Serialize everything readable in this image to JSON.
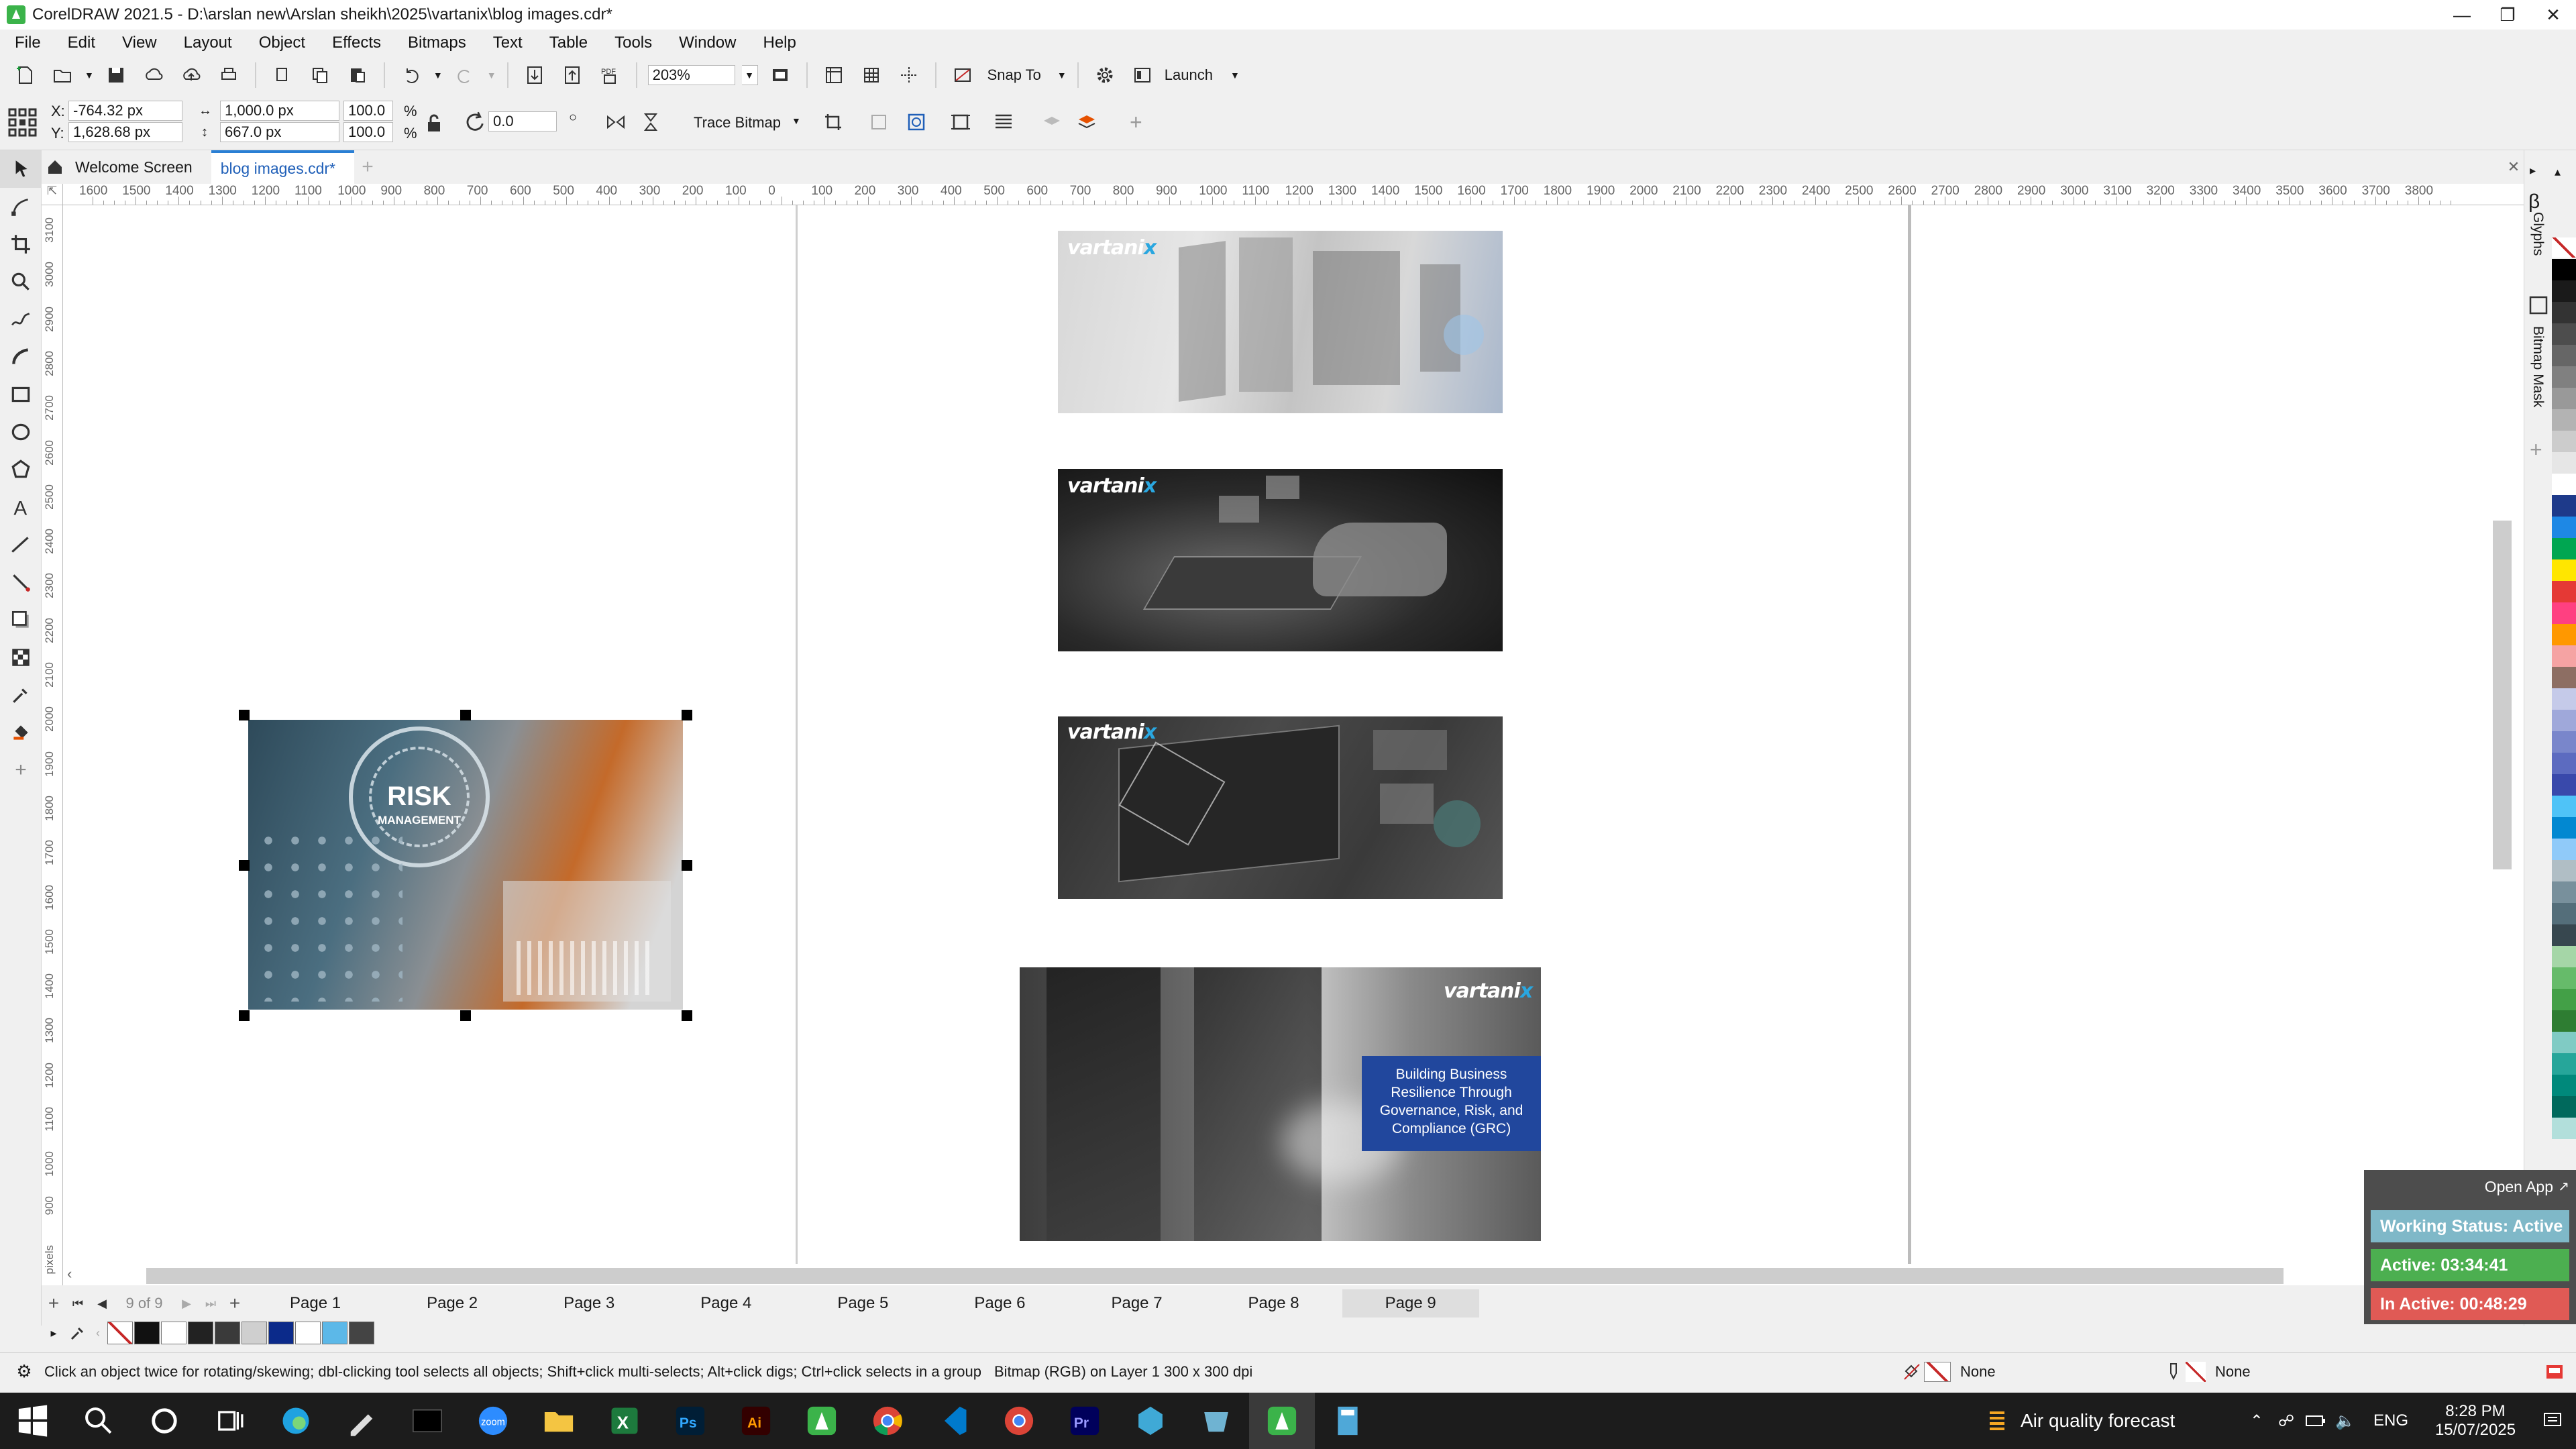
{
  "window": {
    "title": "CorelDRAW 2021.5 - D:\\arslan new\\Arslan sheikh\\2025\\vartanix\\blog images.cdr*",
    "app_icon": "coreldraw-icon",
    "controls": [
      "minimize-icon",
      "restore-icon",
      "close-icon"
    ]
  },
  "menu": [
    "File",
    "Edit",
    "View",
    "Layout",
    "Object",
    "Effects",
    "Bitmaps",
    "Text",
    "Table",
    "Tools",
    "Window",
    "Help"
  ],
  "toolbar": {
    "zoom": "203%",
    "snap_to": "Snap To",
    "launch": "Launch"
  },
  "property_bar": {
    "x_label": "X:",
    "x": "-764.32 px",
    "y_label": "Y:",
    "y": "1,628.68 px",
    "width": "1,000.0 px",
    "height": "667.0 px",
    "scale_w": "100.0",
    "scale_h": "100.0",
    "percent": "%",
    "rotation": "0.0",
    "trace_bitmap": "Trace Bitmap"
  },
  "doc_tabs": [
    "Welcome Screen",
    "blog images.cdr*"
  ],
  "ruler": {
    "top": [
      "1600",
      "1500",
      "1400",
      "1300",
      "1200",
      "1100",
      "1000",
      "900",
      "800",
      "700",
      "600",
      "500",
      "400",
      "300",
      "200",
      "100",
      "0",
      "100",
      "200",
      "300",
      "400",
      "500",
      "600",
      "700",
      "800",
      "900",
      "1000",
      "1100",
      "1200",
      "1300",
      "1400",
      "1500",
      "1600",
      "1700",
      "1800",
      "1900",
      "2000",
      "2100",
      "2200",
      "2300",
      "2400",
      "2500",
      "2600",
      "2700",
      "2800",
      "2900",
      "3000",
      "3100",
      "3200",
      "3300",
      "3400",
      "3500",
      "3600",
      "3700",
      "3800"
    ],
    "unit": "pixels",
    "left": [
      "3100",
      "3000",
      "2900",
      "2800",
      "2700",
      "2600",
      "2500",
      "2400",
      "2300",
      "2200",
      "2100",
      "2000",
      "1900",
      "1800",
      "1700",
      "1600",
      "1500",
      "1400",
      "1300",
      "1200",
      "1100",
      "1000",
      "900"
    ],
    "left_unit": "pixels"
  },
  "canvas": {
    "brand": "vartani",
    "brand_x": "x",
    "risk_title": "RISK",
    "risk_sub": "MANAGEMENT",
    "grc_text": "Building Business Resilience Through Governance, Risk, and Compliance (GRC)"
  },
  "pages": {
    "counter": "9 of 9",
    "tabs": [
      "Page 1",
      "Page 2",
      "Page 3",
      "Page 4",
      "Page 5",
      "Page 6",
      "Page 7",
      "Page 8",
      "Page 9"
    ],
    "active": "Page 9"
  },
  "status": {
    "hint": "Click an object twice for rotating/skewing; dbl-clicking tool selects all objects; Shift+click multi-selects; Alt+click digs; Ctrl+click selects in a group",
    "object_info": "Bitmap (RGB) on Layer 1 300 x 300 dpi",
    "fill": "None",
    "outline": "None"
  },
  "dockers": [
    "Glyphs",
    "Bitmap Mask"
  ],
  "tracker": {
    "open_app": "Open App",
    "working_status": "Working Status: Active",
    "active": "Active: 03:34:41",
    "inactive": "In Active: 00:48:29",
    "colors": {
      "status": "#7fb8c8",
      "active": "#4caf50",
      "inactive": "#e05a55"
    }
  },
  "taskbar": {
    "weather": "Air quality forecast",
    "lang": "ENG",
    "time": "8:28 PM",
    "date": "15/07/2025",
    "apps": [
      "windows-start-icon",
      "search-icon",
      "cortana-icon",
      "task-view-icon",
      "edge-icon",
      "pen-icon",
      "terminal-icon",
      "zoom-icon",
      "file-explorer-icon",
      "excel-icon",
      "photoshop-icon",
      "illustrator-icon",
      "coreldraw-icon",
      "chrome-icon",
      "vscode-icon",
      "chrome-profile-icon",
      "premiere-icon",
      "app-icon",
      "explorer-icon",
      "coreldraw-active-icon",
      "calculator-icon"
    ]
  },
  "palette_colors": [
    "#000000",
    "#1a1a1a",
    "#333333",
    "#4d4d4d",
    "#666666",
    "#808080",
    "#999999",
    "#b3b3b3",
    "#cccccc",
    "#e6e6e6",
    "#ffffff",
    "#1e3a8a",
    "#1e88e5",
    "#00a651",
    "#ffe600",
    "#e53935",
    "#ff4081",
    "#ff9800",
    "#f5a3a3",
    "#8d6e63",
    "#c5cae9",
    "#9fa8da",
    "#7986cb",
    "#5c6bc0",
    "#3949ab",
    "#4fc3f7",
    "#0288d1",
    "#90caf9",
    "#b0bec5",
    "#78909c",
    "#546e7a",
    "#37474f",
    "#a5d6a7",
    "#66bb6a",
    "#43a047",
    "#2e7d32",
    "#80cbc4",
    "#26a69a",
    "#00897b",
    "#00695c",
    "#b2dfdb"
  ]
}
